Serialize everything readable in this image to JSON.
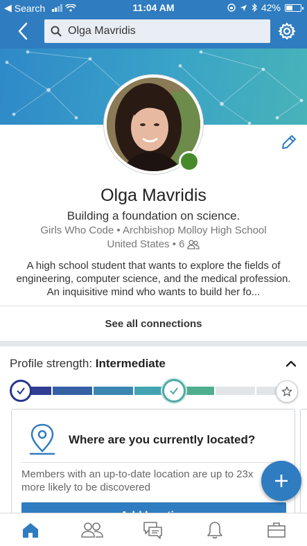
{
  "status_bar": {
    "back_app": "Search",
    "time": "11:04 AM",
    "battery": "42%"
  },
  "nav": {
    "search_value": "Olga Mavridis"
  },
  "profile": {
    "name": "Olga Mavridis",
    "headline": "Building a foundation on science.",
    "subline": "Girls Who Code • Archbishop Molloy High School",
    "location": "United States • 6",
    "summary": "A high school student that wants to explore the fields of engineering, computer science, and the medical profession.  An inquisitive mind who wants to build her fo..."
  },
  "connections": {
    "see_all_label": "See all connections"
  },
  "strength": {
    "label": "Profile strength: ",
    "level": "Intermediate",
    "fraction": 0.57
  },
  "card": {
    "title": "Where are you currently located?",
    "body": "Members with an up-to-date location are up to 23x more likely to be discovered",
    "button_label": "Add location"
  },
  "tabs": [
    "home",
    "my-network",
    "messaging",
    "notifications",
    "jobs"
  ],
  "colors": {
    "brand_blue": "#2f7cc0",
    "presence_green": "#468a2b",
    "meter_start": "#27358c",
    "meter_end": "#4fb38d"
  }
}
